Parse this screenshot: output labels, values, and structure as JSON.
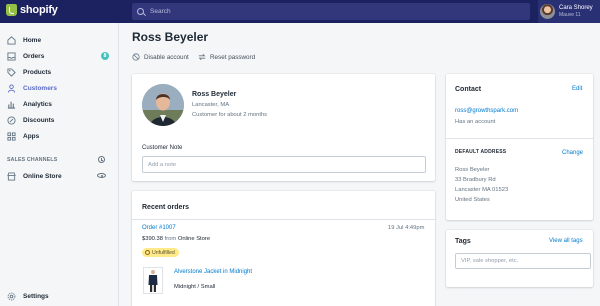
{
  "topbar": {
    "logo_text": "shopify",
    "search_placeholder": "Search",
    "user_name": "Cara Shorey",
    "user_shop": "Mauve 11"
  },
  "sidebar": {
    "items": [
      {
        "label": "Home",
        "icon": "home-icon"
      },
      {
        "label": "Orders",
        "icon": "orders-icon",
        "badge": "8"
      },
      {
        "label": "Products",
        "icon": "tag-icon"
      },
      {
        "label": "Customers",
        "icon": "person-icon",
        "active": true
      },
      {
        "label": "Analytics",
        "icon": "bar-chart-icon"
      },
      {
        "label": "Discounts",
        "icon": "discount-icon"
      },
      {
        "label": "Apps",
        "icon": "apps-icon"
      }
    ],
    "sales_channels_label": "SALES CHANNELS",
    "online_store_label": "Online Store",
    "settings_label": "Settings"
  },
  "page": {
    "title": "Ross Beyeler",
    "disable_label": "Disable account",
    "reset_label": "Reset password"
  },
  "customer": {
    "name": "Ross Beyeler",
    "location": "Lancaster, MA",
    "since": "Customer for about 2 months",
    "note_label": "Customer Note",
    "note_placeholder": "Add a note"
  },
  "orders": {
    "heading": "Recent orders",
    "order_number": "Order #1007",
    "date": "19 Jul 4:49pm",
    "amount": "$390.38",
    "from_word": "from",
    "source": "Online Store",
    "status": "Unfulfilled",
    "product_name": "Alverstone Jacket in Midnight",
    "variant": "Midnight / Small"
  },
  "contact": {
    "heading": "Contact",
    "edit_label": "Edit",
    "email": "ross@growthspark.com",
    "account_status": "Has an account",
    "address_heading": "DEFAULT ADDRESS",
    "change_label": "Change",
    "address_lines": [
      "Ross Beyeler",
      "33 Bradbury Rd",
      "Lancaster MA 01523",
      "United States"
    ]
  },
  "tags": {
    "heading": "Tags",
    "view_all_label": "View all tags",
    "placeholder": "VIP, sale shopper, etc."
  },
  "colors": {
    "topbar": "#1c2260",
    "accent": "#5c6ac4",
    "link": "#007ace",
    "badge": "#47c1bf",
    "unfulfilled": "#ffea8a"
  }
}
